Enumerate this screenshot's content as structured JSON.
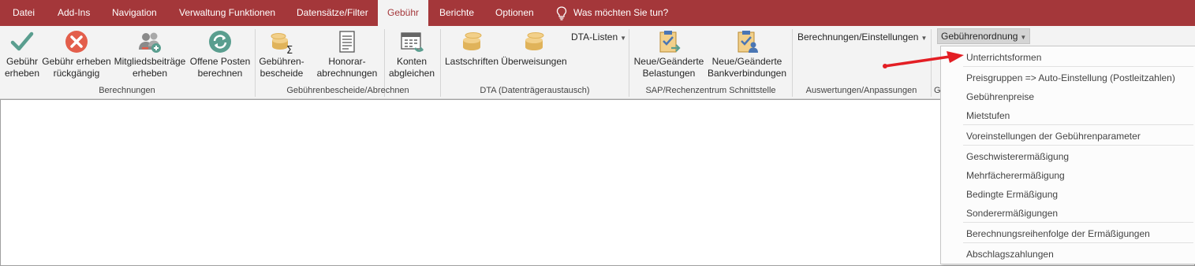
{
  "tabs": [
    {
      "label": "Datei"
    },
    {
      "label": "Add-Ins"
    },
    {
      "label": "Navigation"
    },
    {
      "label": "Verwaltung Funktionen"
    },
    {
      "label": "Datensätze/Filter"
    },
    {
      "label": "Gebühr",
      "active": true
    },
    {
      "label": "Berichte"
    },
    {
      "label": "Optionen"
    }
  ],
  "tellme": {
    "text": "Was möchten Sie tun?",
    "icon": "lightbulb-icon"
  },
  "ribbon": {
    "berechnungen": {
      "label": "Berechnungen",
      "buttons": [
        {
          "label": "Gebühr\nerheben",
          "icon": "checkmark-icon",
          "color": "#5a9e8f"
        },
        {
          "label": "Gebühr erheben\nrückgängig",
          "icon": "cancel-circle-icon",
          "color": "#e35e4b"
        },
        {
          "label": "Mitgliedsbeiträge\nerheben",
          "icon": "members-icon"
        },
        {
          "label": "Offene Posten\nberechnen",
          "icon": "refresh-circle-icon",
          "color": "#5a9e8f"
        }
      ]
    },
    "bescheide": {
      "label": "Gebührenbescheide/Abrechnen",
      "buttons": [
        {
          "label": "Gebühren-\nbescheide",
          "icon": "coins-sum-icon"
        },
        {
          "label": "Honorar-\nabrechnungen",
          "icon": "document-icon"
        },
        {
          "label": "Konten\nabgleichen",
          "icon": "calendar-arrow-icon"
        }
      ]
    },
    "dta": {
      "label": "DTA (Datenträgeraustausch)",
      "buttons": [
        {
          "label": "Lastschriften",
          "icon": "coins-icon"
        },
        {
          "label": "Überweisungen",
          "icon": "coins-icon"
        }
      ],
      "dropdown": "DTA-Listen"
    },
    "sap": {
      "label": "SAP/Rechenzentrum Schnittstelle",
      "buttons": [
        {
          "label": "Neue/Geänderte\nBelastungen",
          "icon": "clipboard-check-icon"
        },
        {
          "label": "Neue/Geänderte\nBankverbindungen",
          "icon": "clipboard-person-icon"
        }
      ]
    },
    "auswertungen": {
      "label": "Auswertungen/Anpassungen",
      "dropdown": "Berechnungen/Einstellungen"
    },
    "gebuehrenordnung": {
      "label": "G",
      "dropdown": "Gebührenordnung"
    }
  },
  "menu": {
    "items": [
      "Unterrichtsformen",
      "Preisgruppen => Auto-Einstellung (Postleitzahlen)",
      "Gebührenpreise",
      "Mietstufen",
      "Voreinstellungen der Gebührenparameter",
      "Geschwisterermäßigung",
      "Mehrfächerermäßigung",
      "Bedingte Ermäßigung",
      "Sonderermäßigungen",
      "Berechnungsreihenfolge der Ermäßigungen",
      "Abschlagszahlungen"
    ]
  },
  "colors": {
    "titlebar": "#a4373a",
    "ribbon": "#f3f3f3",
    "annotation_arrow": "#e31e24"
  }
}
